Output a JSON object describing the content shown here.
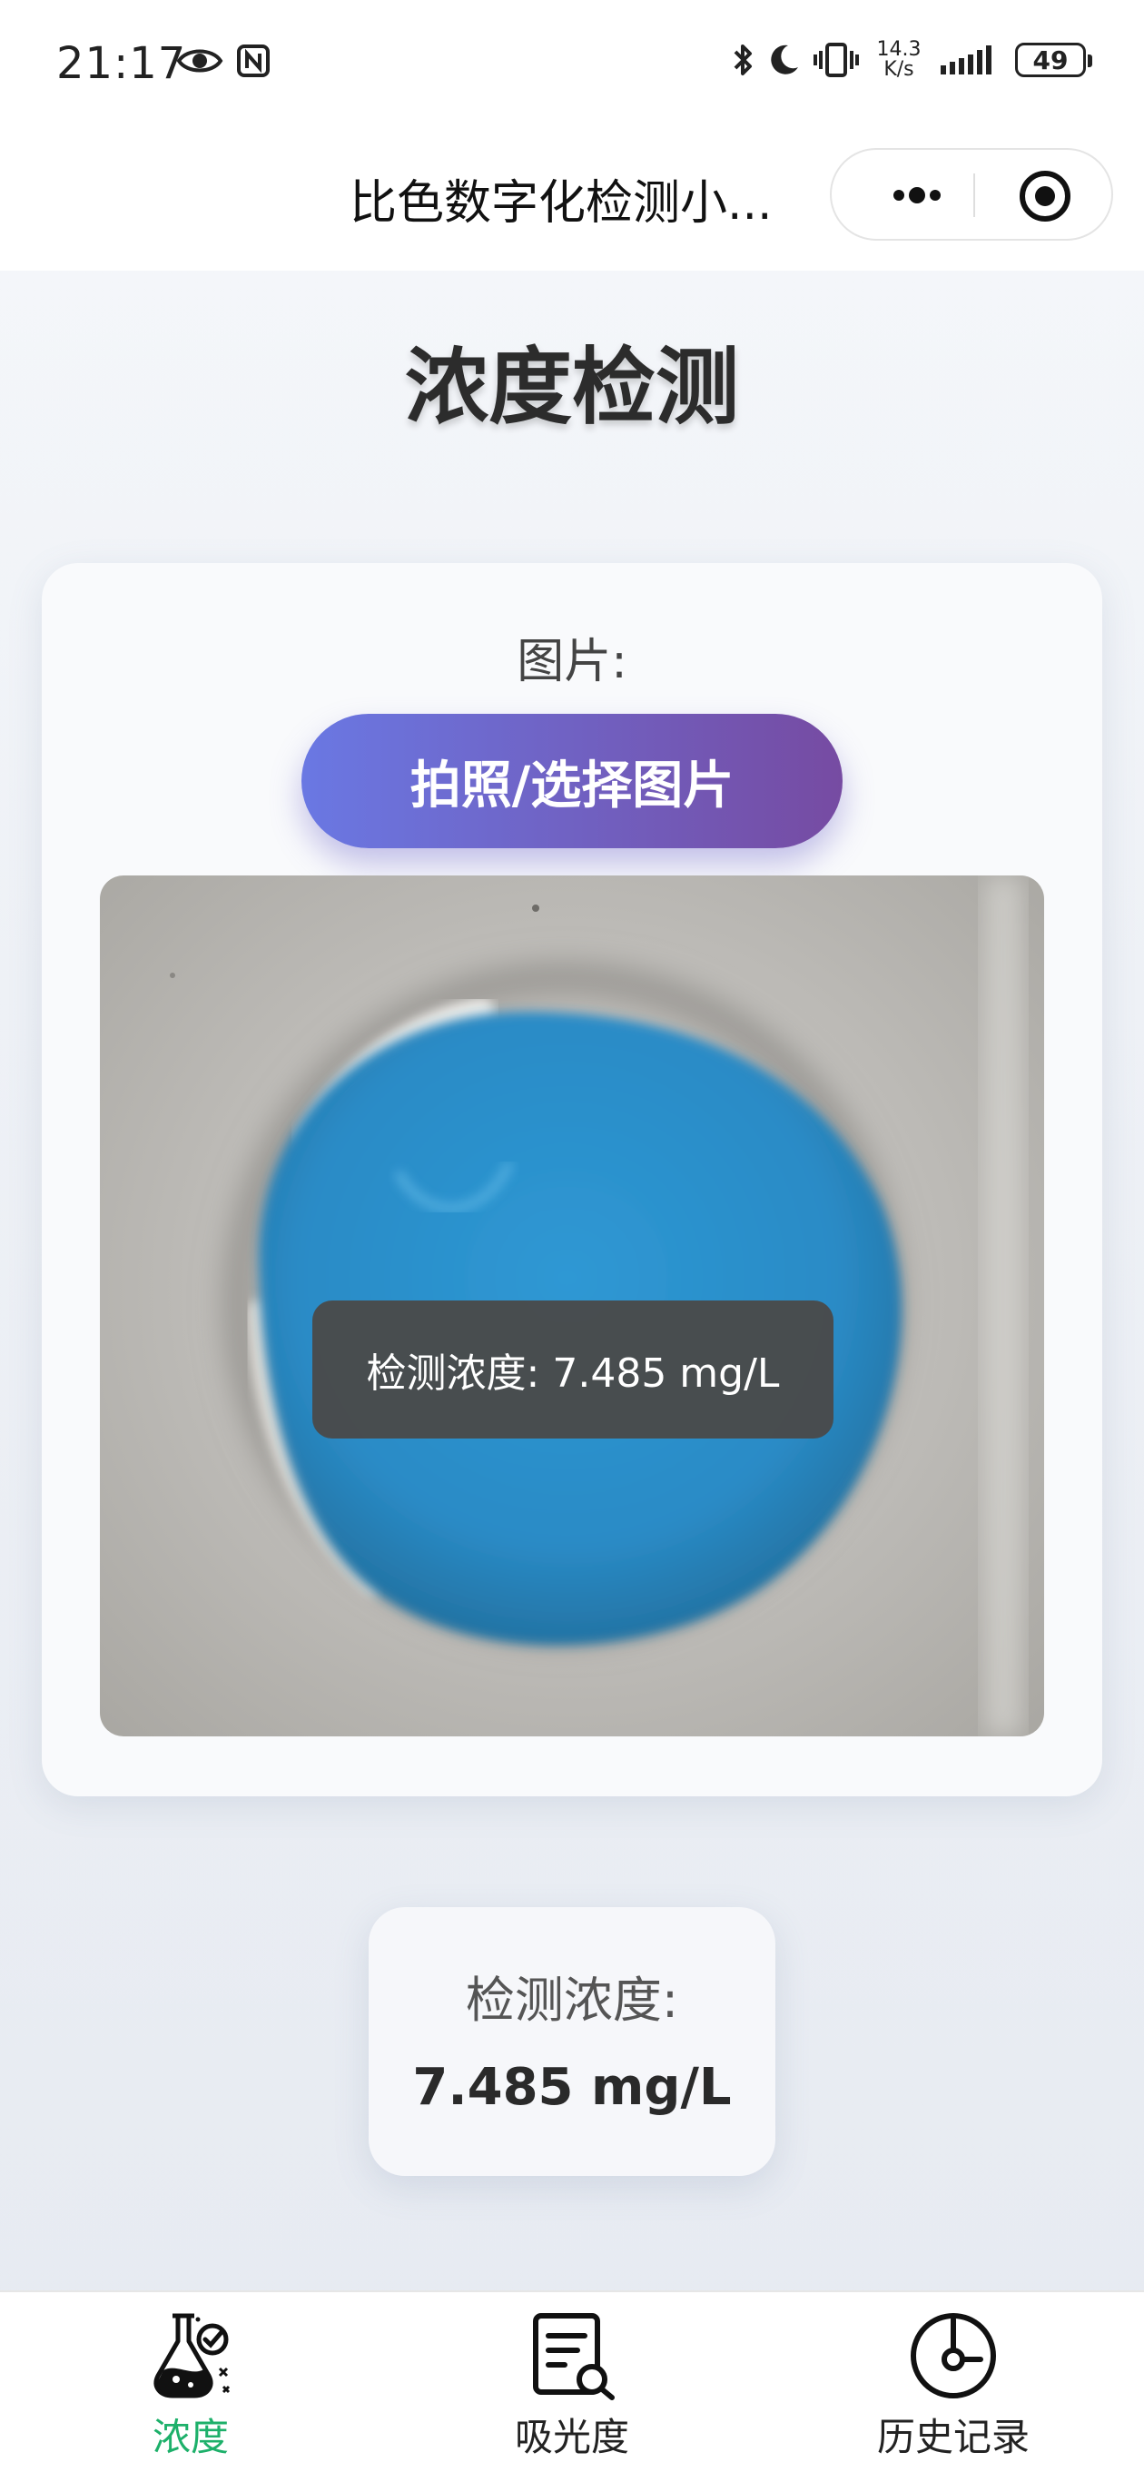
{
  "status_bar": {
    "time": "21:17",
    "net_speed_value": "14.3",
    "net_speed_unit": "K/s",
    "battery": "49"
  },
  "nav_bar": {
    "title": "比色数字化检测小..."
  },
  "page": {
    "title": "浓度检测",
    "image_label": "图片:",
    "pick_button_label": "拍照/选择图片",
    "toast_text": "检测浓度: 7.485 mg/L",
    "result_label": "检测浓度:",
    "result_value": "7.485 mg/L"
  },
  "tab_bar": {
    "active_color": "#1db06a",
    "items": [
      {
        "label": "浓度",
        "icon": "flask-icon",
        "active": true
      },
      {
        "label": "吸光度",
        "icon": "document-search-icon",
        "active": false
      },
      {
        "label": "历史记录",
        "icon": "history-icon",
        "active": false
      }
    ]
  }
}
